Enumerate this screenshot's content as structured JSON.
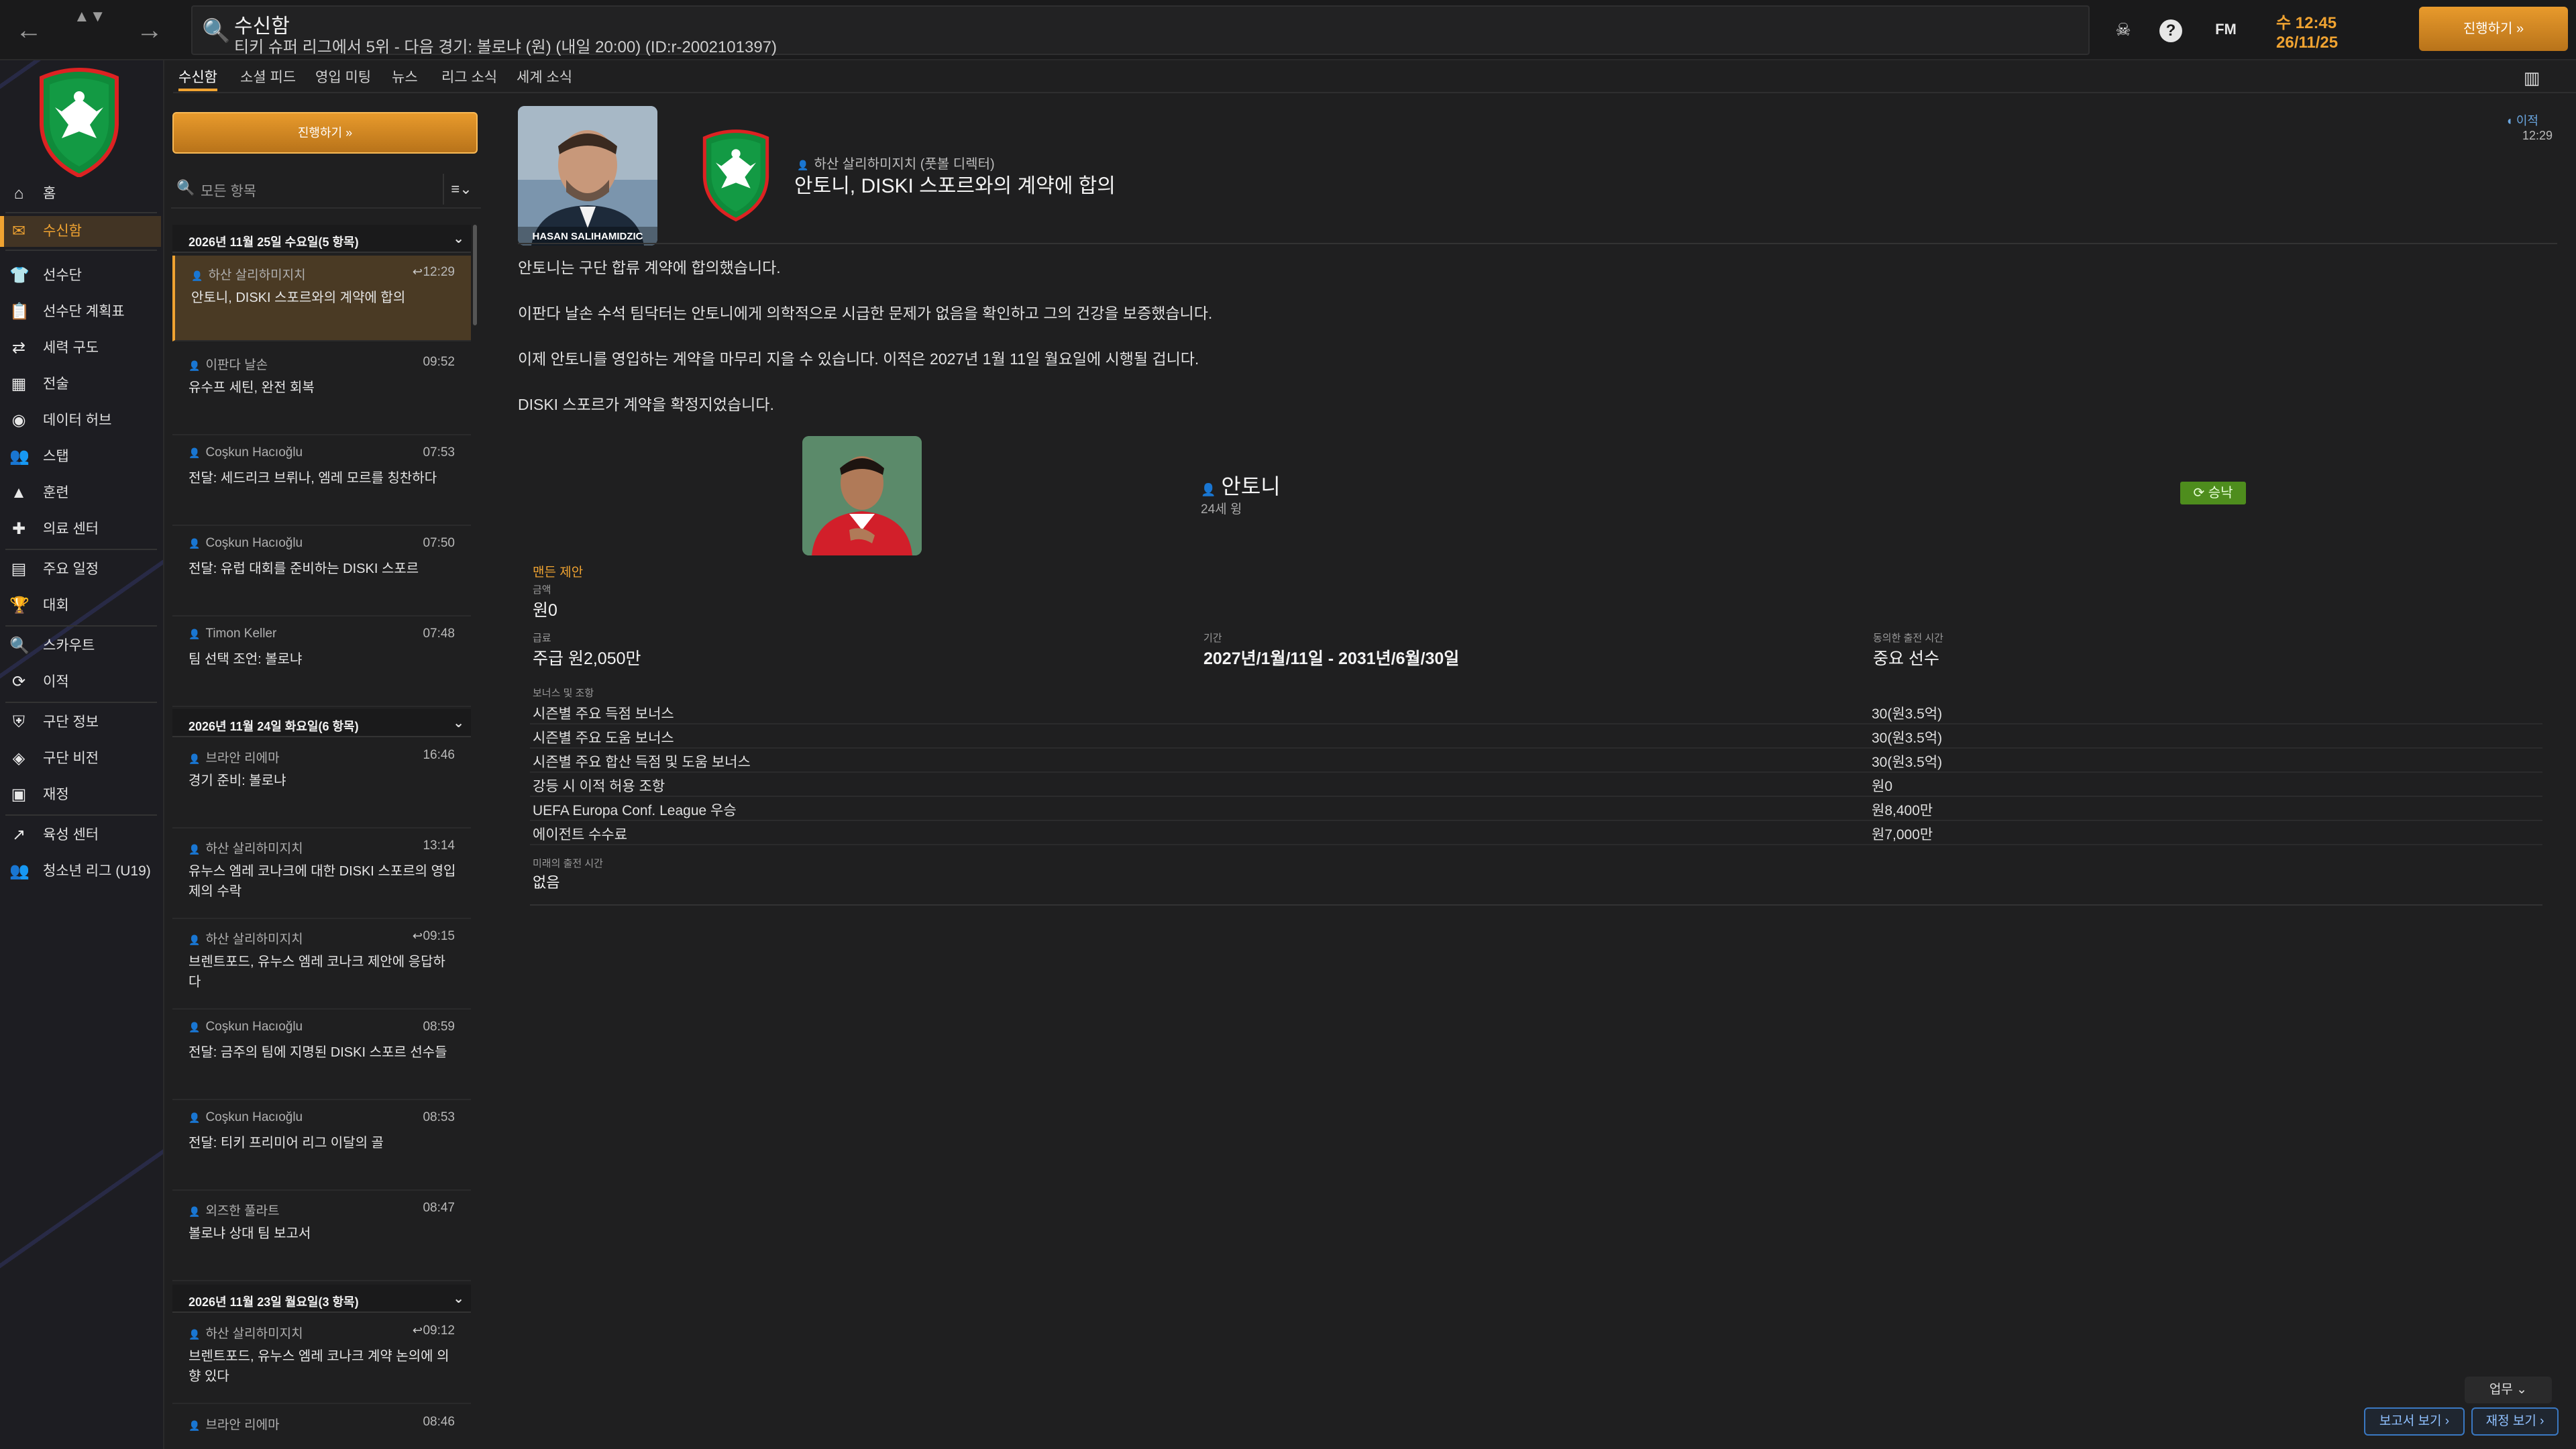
{
  "topbar": {
    "back_icon": "←",
    "forward_icon": "→",
    "updown_icon": "▲▼",
    "search_icon": "🔍",
    "title": "수신함",
    "subtitle": "티키 슈퍼 리그에서 5위 - 다음 경기: 볼로냐 (원) (내일 20:00) (ID:r-2002101397)",
    "skull_icon": "☠",
    "help_icon": "?",
    "fm_label": "FM",
    "clock_time": "수 12:45",
    "clock_date": "26/11/25",
    "continue_label": "진행하기 »"
  },
  "sidebar": {
    "items": [
      {
        "icon": "⌂",
        "label": "홈"
      },
      {
        "icon": "✉",
        "label": "수신함",
        "active": true
      },
      {
        "icon": "👕",
        "label": "선수단"
      },
      {
        "icon": "📋",
        "label": "선수단 계획표"
      },
      {
        "icon": "⇄",
        "label": "세력 구도"
      },
      {
        "icon": "▦",
        "label": "전술"
      },
      {
        "icon": "◉",
        "label": "데이터 허브"
      },
      {
        "icon": "👥",
        "label": "스탭"
      },
      {
        "icon": "▲",
        "label": "훈련"
      },
      {
        "icon": "✚",
        "label": "의료 센터"
      },
      {
        "icon": "▤",
        "label": "주요 일정"
      },
      {
        "icon": "🏆",
        "label": "대회"
      },
      {
        "icon": "🔍",
        "label": "스카우트"
      },
      {
        "icon": "⟳",
        "label": "이적"
      },
      {
        "icon": "⛨",
        "label": "구단 정보"
      },
      {
        "icon": "◈",
        "label": "구단 비전"
      },
      {
        "icon": "▣",
        "label": "재정"
      },
      {
        "icon": "↗",
        "label": "육성 센터"
      },
      {
        "icon": "👥",
        "label": "청소년 리그 (U19)"
      }
    ]
  },
  "tabs": [
    "수신함",
    "소셜 피드",
    "영입 미팅",
    "뉴스",
    "리그 소식",
    "세계 소식"
  ],
  "inbox": {
    "continue_label": "진행하기 »",
    "filter_placeholder": "모든 항목",
    "filter_menu_icon": "≡⌄",
    "groups": [
      {
        "date": "2026년 11월 25일 수요일(5 항목)",
        "messages": [
          {
            "sender": "하산 살리하미지치",
            "time": "12:29",
            "subject": "안토니, DISKI 스포르와의 계약에 합의",
            "reply": "↩",
            "active": true
          },
          {
            "sender": "이판다 날손",
            "time": "09:52",
            "subject": "유수프 세틴, 완전 회복"
          },
          {
            "sender": "Coşkun Hacıoğlu",
            "time": "07:53",
            "subject": "전달: 세드리크 브뤼나, 엠레 모르를 칭찬하다"
          },
          {
            "sender": "Coşkun Hacıoğlu",
            "time": "07:50",
            "subject": "전달: 유럽 대회를 준비하는 DISKI 스포르"
          },
          {
            "sender": "Timon Keller",
            "time": "07:48",
            "subject": "팀 선택 조언: 볼로냐"
          }
        ]
      },
      {
        "date": "2026년 11월 24일 화요일(6 항목)",
        "messages": [
          {
            "sender": "브라안 리에마",
            "time": "16:46",
            "subject": "경기 준비: 볼로냐"
          },
          {
            "sender": "하산 살리하미지치",
            "time": "13:14",
            "subject": "유누스 엠레 코나크에 대한 DISKI 스포르의 영입 제의 수락"
          },
          {
            "sender": "하산 살리하미지치",
            "time": "09:15",
            "subject": "브렌트포드, 유누스 엠레 코나크 제안에 응답하다",
            "reply": "↩"
          },
          {
            "sender": "Coşkun Hacıoğlu",
            "time": "08:59",
            "subject": "전달: 금주의 팀에 지명된 DISKI 스포르 선수들"
          },
          {
            "sender": "Coşkun Hacıoğlu",
            "time": "08:53",
            "subject": "전달: 티키 프리미어 리그 이달의 골"
          },
          {
            "sender": "외즈한 풀라트",
            "time": "08:47",
            "subject": "볼로냐 상대 팀 보고서"
          }
        ]
      },
      {
        "date": "2026년 11월 23일 월요일(3 항목)",
        "messages": [
          {
            "sender": "하산 살리하미지치",
            "time": "09:12",
            "subject": "브렌트포드, 유누스 엠레 코나크 계약 논의에 의향 있다",
            "reply": "↩"
          },
          {
            "sender": "브라안 리에마",
            "time": "08:46",
            "subject": ""
          }
        ]
      }
    ]
  },
  "message": {
    "photo_caption": "HASAN SALIHAMIDZIC",
    "from": "하산 살리하미지치 (풋볼 디렉터)",
    "subject": "안토니, DISKI 스포르와의 계약에 합의",
    "time_icon_label": "◖ 이적",
    "time": "12:29",
    "paragraphs": [
      "안토니는 구단 합류 계약에 합의했습니다.",
      "이판다 날손 수석 팀닥터는 안토니에게 의학적으로 시급한 문제가 없음을 확인하고 그의 건강을 보증했습니다.",
      "이제 안토니를 영입하는 계약을 마무리 지을 수 있습니다. 이적은 2027년 1월 11일 월요일에 시행될 겁니다.",
      "DISKI 스포르가 계약을 확정지었습니다."
    ],
    "player": {
      "name": "안토니",
      "age": "24세 윙",
      "status": "⟳ 승낙"
    },
    "section_title": "맨든 제안",
    "fee_label": "금액",
    "fee_value": "원0",
    "wage_label": "급료",
    "wage_value": "주급 원2,050만",
    "period_label": "기간",
    "period_value": "2027년/1월/11일 - 2031년/6월/30일",
    "playing_time_label": "동의한 출전 시간",
    "playing_time_value": "중요 선수",
    "bonus_title": "보너스 및 조항",
    "bonuses": [
      {
        "name": "시즌별 주요 득점 보너스",
        "value": "30(원3.5억)"
      },
      {
        "name": "시즌별 주요 도움 보너스",
        "value": "30(원3.5억)"
      },
      {
        "name": "시즌별 주요 합산 득점 및 도움 보너스",
        "value": "30(원3.5억)"
      },
      {
        "name": "강등 시 이적 허용 조항",
        "value": "원0"
      },
      {
        "name": "UEFA Europa Conf. League 우승",
        "value": "원8,400만"
      },
      {
        "name": "에이전트 수수료",
        "value": "원7,000만"
      }
    ],
    "future_label": "미래의 출전 시간",
    "future_value": "없음"
  },
  "bottom": {
    "task_label": "업무 ⌄",
    "report_label": "보고서 보기 ›",
    "finance_label": "재정 보기 ›",
    "side_toggle_icon": "▥"
  },
  "colors": {
    "accent": "#f0a331",
    "accepted": "#4e8d1d",
    "link": "#3a78c2"
  }
}
